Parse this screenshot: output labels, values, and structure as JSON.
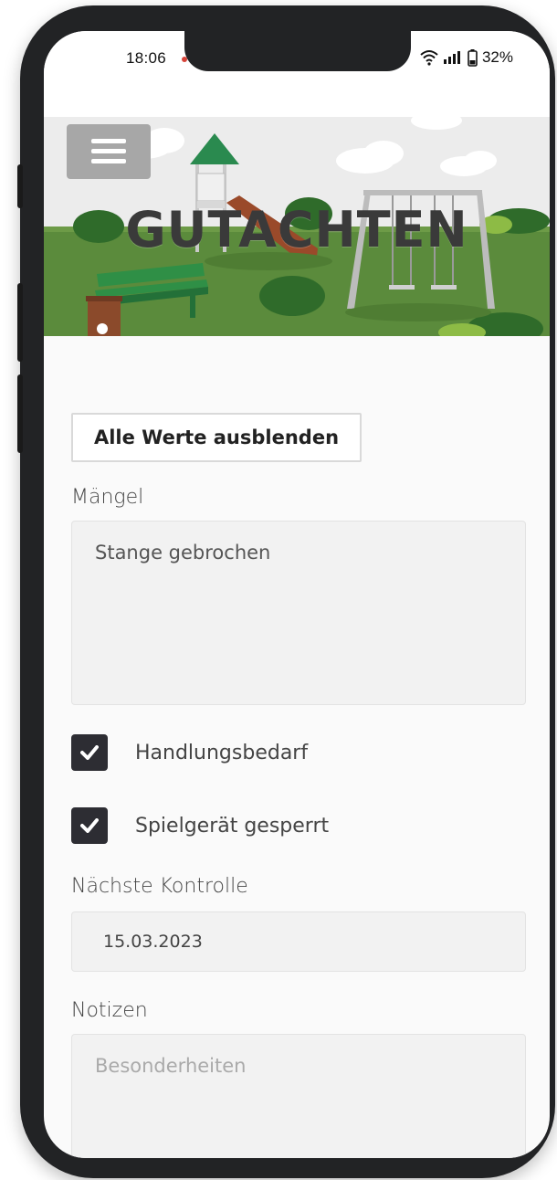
{
  "status": {
    "time": "18:06",
    "battery": "32%"
  },
  "header": {
    "title": "GUTACHTEN",
    "menu_icon": "hamburger-icon"
  },
  "actions": {
    "toggle_values_label": "Alle Werte ausblenden"
  },
  "form": {
    "defects": {
      "label": "Mängel",
      "value": "Stange gebrochen"
    },
    "action_needed": {
      "label": "Handlungsbedarf",
      "checked": true
    },
    "equipment_locked": {
      "label": "Spielgerät gesperrt",
      "checked": true
    },
    "next_inspection": {
      "label": "Nächste Kontrolle",
      "value": "15.03.2023"
    },
    "notes": {
      "label": "Notizen",
      "placeholder": "Besonderheiten",
      "value": ""
    }
  },
  "colors": {
    "accent_dark": "#2d2d33",
    "grass": "#5b8b3c",
    "menu_button": "#a7a7a7"
  }
}
